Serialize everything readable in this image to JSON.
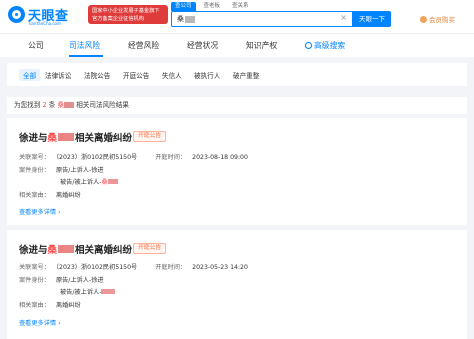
{
  "header": {
    "logo_text": "天眼查",
    "logo_sub": "TianYanCha.com",
    "banner_line1": "国家中小企业发展子基金旗下",
    "banner_line2": "官方备案企业征信机构",
    "search_tabs": [
      "查公司",
      "查老板",
      "查关系"
    ],
    "search_value": "桑",
    "search_clear": "×",
    "search_button": "天眼一下",
    "vip_label": "会员购买"
  },
  "mainnav": {
    "items": [
      "公司",
      "司法风险",
      "经营风险",
      "经营状况",
      "知识产权",
      "高级搜索"
    ],
    "active": "司法风险"
  },
  "subnav": {
    "items": [
      "全部",
      "法律诉讼",
      "法院公告",
      "开庭公告",
      "失信人",
      "被执行人",
      "破产重整"
    ],
    "active": "全部"
  },
  "results": {
    "prefix": "为您找到",
    "count": "2",
    "mid": "条",
    "keyword": "桑",
    "suffix": "相关司法风险结果"
  },
  "cases": [
    {
      "title_prefix": "徐进与",
      "title_name": "桑",
      "title_suffix": "相关离婚纠纷",
      "badge": "开庭公告",
      "case_no_label": "关联案号：",
      "case_no": "（2023）浙0102民初5150号",
      "date_label": "开庭时间：",
      "date": "2023-08-18 09:00",
      "role_label": "案件身份：",
      "role_line1": "原告/上诉人-徐进",
      "role_line2_prefix": "被告/被上诉人-",
      "role_line2_name": "桑",
      "cause_label": "相关案由：",
      "cause": "离婚纠纷",
      "more": "查看更多详情"
    },
    {
      "title_prefix": "徐进与",
      "title_name": "桑",
      "title_suffix": "相关离婚纠纷",
      "badge": "开庭公告",
      "case_no_label": "关联案号：",
      "case_no": "（2023）浙0102民初5150号",
      "date_label": "开庭时间：",
      "date": "2023-05-23 14:20",
      "role_label": "案件身份：",
      "role_line1": "原告/上诉人-徐进",
      "role_line2_prefix": "被告/被上诉人-",
      "role_line2_name": "",
      "cause_label": "相关案由：",
      "cause": "离婚纠纷",
      "more": "查看更多详情"
    }
  ],
  "colors": {
    "brand": "#0084ff",
    "highlight": "#ff4d4f",
    "badge": "#ff6a3d"
  }
}
